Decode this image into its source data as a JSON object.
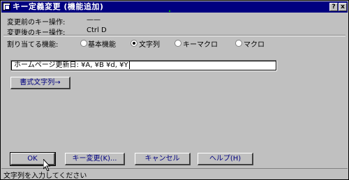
{
  "window": {
    "title": "キー定義変更 (機能追加)"
  },
  "title_buttons": {
    "help": "?",
    "close": "x"
  },
  "info": {
    "before_label": "変更前のキー操作:",
    "before_value": "——",
    "after_label": "変更後のキー操作:",
    "after_value": "Ctrl D"
  },
  "assign": {
    "label": "割り当てる機能:",
    "options": [
      {
        "label": "基本機能",
        "checked": false
      },
      {
        "label": "文字列",
        "checked": true
      },
      {
        "label": "キーマクロ",
        "checked": false
      },
      {
        "label": "マクロ",
        "checked": false
      }
    ]
  },
  "text_input": {
    "value": "ホームページ更新日: ¥A, ¥B ¥d, ¥Y"
  },
  "format_button": {
    "label": "書式文字列→"
  },
  "buttons": {
    "ok": "OK",
    "key_change": "キー変更(K)...",
    "cancel": "キャンセル",
    "help": "ヘルプ(H)"
  },
  "status": {
    "text": "文字列を入力してください"
  }
}
